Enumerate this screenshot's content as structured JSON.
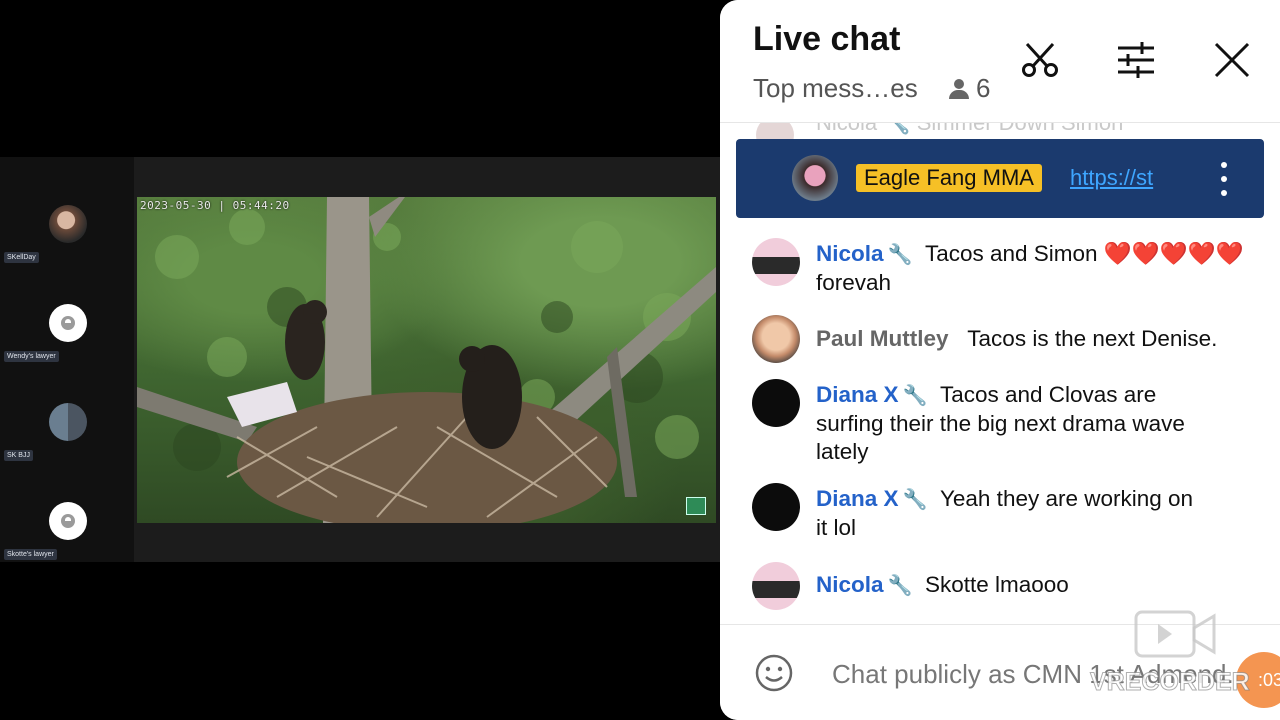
{
  "video": {
    "timestamp": "2023-05-30 | 05:44:20",
    "participants": [
      {
        "name": "SKellDay",
        "avatar": "photo"
      },
      {
        "name": "Wendy's lawyer",
        "avatar": "default-user-icon"
      },
      {
        "name": "SK BJJ",
        "avatar": "photo"
      },
      {
        "name": "Skotte's lawyer",
        "avatar": "default-user-icon"
      }
    ]
  },
  "chat": {
    "title": "Live chat",
    "mode": "Top mess…es",
    "viewer_count": "6",
    "peek_text": "Nicola  🔧 Simmer Down Simon",
    "pinned": {
      "badge": "Eagle Fang MMA",
      "link": "https://st"
    },
    "messages": [
      {
        "author": "Nicola",
        "moderator": true,
        "text": "Tacos and Simon ",
        "hearts": "❤️❤️❤️❤️❤️",
        "tail": " forevah"
      },
      {
        "author": "Paul Muttley",
        "moderator": false,
        "text": "Tacos is the next Denise."
      },
      {
        "author": "Diana X",
        "moderator": true,
        "text": "Tacos and Clovas are surfing their the big next drama wave lately"
      },
      {
        "author": "Diana X",
        "moderator": true,
        "text": "Yeah they are working on it lol"
      },
      {
        "author": "Nicola",
        "moderator": true,
        "text": "Skotte lmaooo"
      }
    ],
    "input_placeholder": "Chat publicly as CMN 1st Admend..."
  },
  "watermark": {
    "text": "VRECORDER",
    "time": ":03"
  },
  "colors": {
    "pinned_bg": "#1b3a6e",
    "badge_bg": "#f6c026",
    "moderator": "#2462c9",
    "link": "#3ea6ff"
  }
}
